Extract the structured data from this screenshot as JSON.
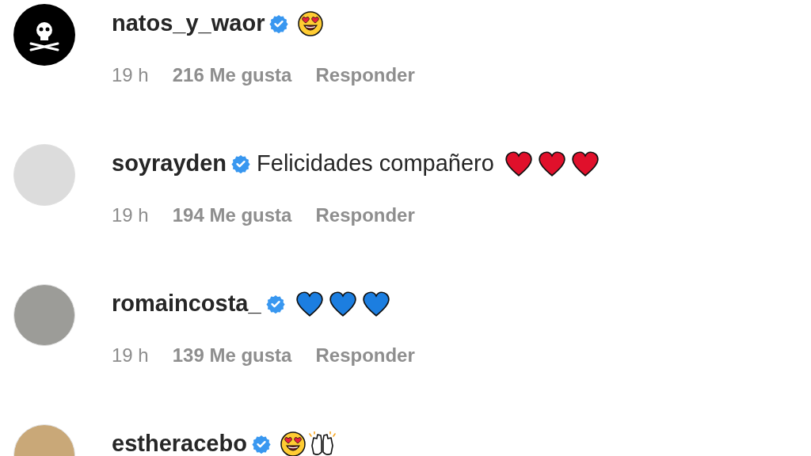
{
  "comments": [
    {
      "kind": "logo",
      "username": "natos_y_waor",
      "verified": true,
      "emojis": [
        {
          "kind": "heart-eyes"
        }
      ],
      "time": "19 h",
      "likes": "216 Me gusta",
      "reply": "Responder"
    },
    {
      "kind": "photo",
      "username": "soyrayden",
      "verified": true,
      "text": "Felicidades compañero",
      "emojis": [
        {
          "kind": "red-heart"
        },
        {
          "kind": "red-heart"
        },
        {
          "kind": "red-heart"
        }
      ],
      "time": "19 h",
      "likes": "194 Me gusta",
      "reply": "Responder"
    },
    {
      "kind": "photo",
      "username": "romaincosta_",
      "verified": true,
      "emojis": [
        {
          "kind": "blue-heart"
        },
        {
          "kind": "blue-heart"
        },
        {
          "kind": "blue-heart"
        }
      ],
      "time": "19 h",
      "likes": "139 Me gusta",
      "reply": "Responder"
    },
    {
      "kind": "photo",
      "username": "estheracebo",
      "verified": true,
      "emojis": [
        {
          "kind": "heart-eyes"
        },
        {
          "kind": "raising-hands"
        }
      ]
    }
  ]
}
